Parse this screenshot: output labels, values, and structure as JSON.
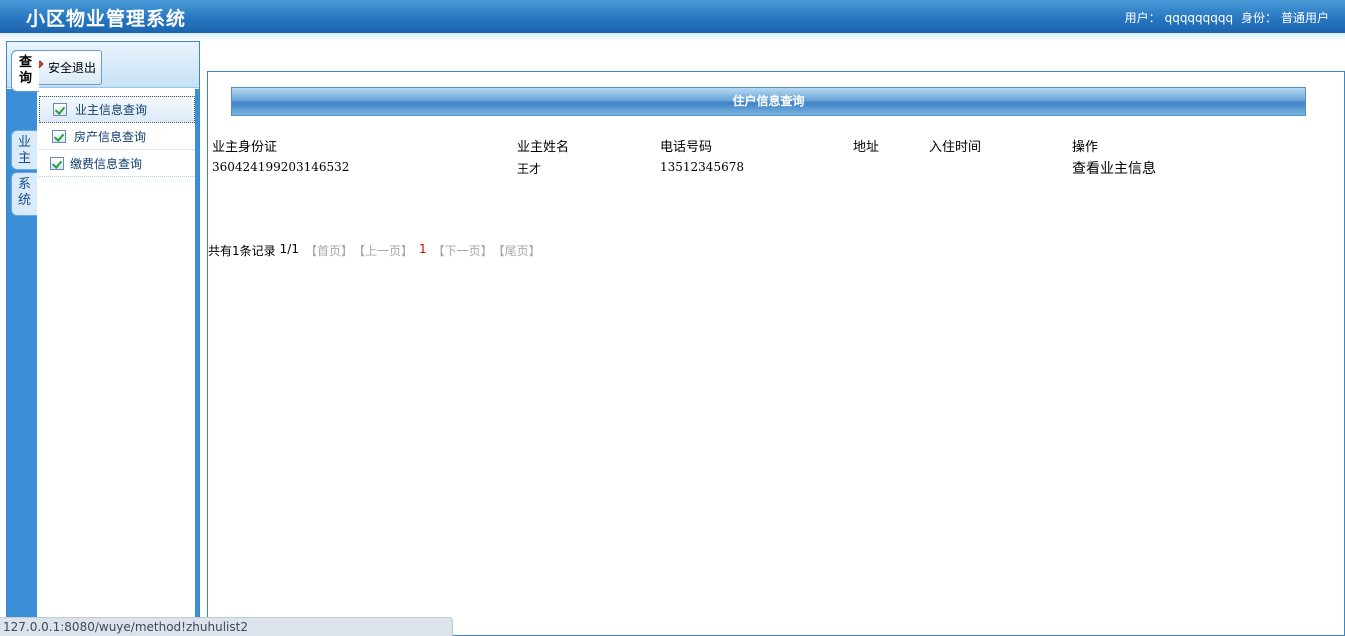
{
  "header": {
    "title": "小区物业管理系统",
    "user_label": "用户：",
    "user_value": "qqqqqqqqq",
    "role_label": "身份：",
    "role_value": "普通用户"
  },
  "sidebar": {
    "logout_label": "安全退出",
    "tabs": [
      {
        "label": "查\n询"
      },
      {
        "label": "业\n主"
      },
      {
        "label": "系\n统"
      }
    ],
    "menu_items": [
      {
        "label": "业主信息查询"
      },
      {
        "label": "房产信息查询"
      },
      {
        "label": "缴费信息查询"
      }
    ]
  },
  "main": {
    "title": "住户信息查询",
    "columns": [
      "业主身份证",
      "业主姓名",
      "电话号码",
      "地址",
      "入住时间",
      "操作"
    ],
    "rows": [
      {
        "id_card": "360424199203146532",
        "name": "王才",
        "phone": "13512345678",
        "address": "",
        "checkin": "",
        "action": "查看业主信息"
      }
    ],
    "pager": {
      "total": "共有1条记录",
      "page": "1/1",
      "first": "【首页】",
      "prev": "【上一页】",
      "current": "1",
      "next": "【下一页】",
      "last": "【尾页】"
    }
  },
  "statusbar": {
    "url": "127.0.0.1:8080/wuye/method!zhuhulist2"
  },
  "colors": {
    "header_blue": "#2877c2",
    "accent_red": "#d40000"
  }
}
